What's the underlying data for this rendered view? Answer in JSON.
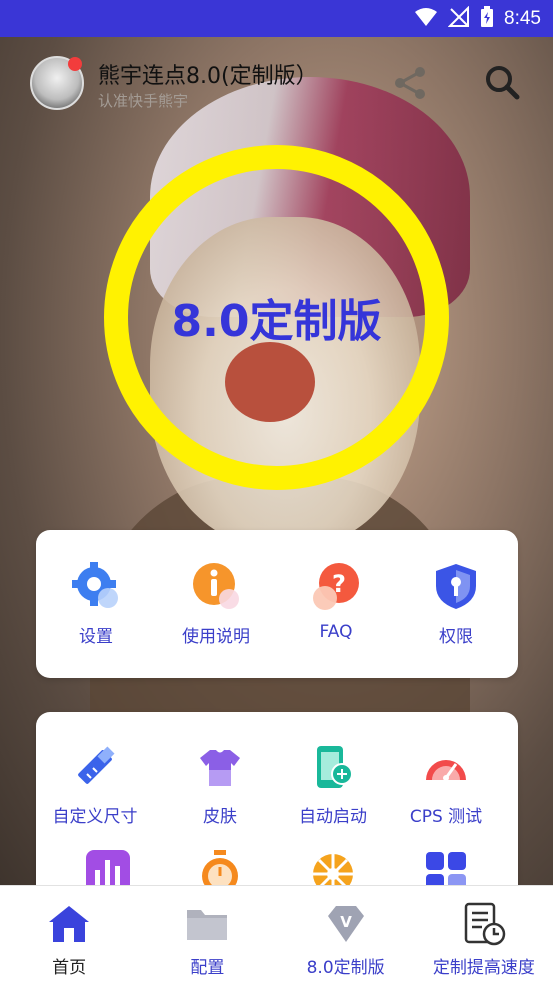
{
  "status": {
    "time": "8:45"
  },
  "header": {
    "title": "熊宇连点8.0(定制版）",
    "subtitle": "认准快手熊宇"
  },
  "hero": {
    "ring_label": "8.0定制版",
    "ring_color": "#fff201",
    "label_color": "#3535d9"
  },
  "quick_menu": [
    {
      "label": "设置",
      "icon": "gear-icon"
    },
    {
      "label": "使用说明",
      "icon": "info-icon"
    },
    {
      "label": "FAQ",
      "icon": "question-icon"
    },
    {
      "label": "权限",
      "icon": "shield-key-icon"
    }
  ],
  "tools_menu": [
    {
      "label": "自定义尺寸",
      "icon": "ruler-pencil-icon"
    },
    {
      "label": "皮肤",
      "icon": "tshirt-icon"
    },
    {
      "label": "自动启动",
      "icon": "phone-link-icon"
    },
    {
      "label": "CPS 测试",
      "icon": "speedometer-icon"
    },
    {
      "label": "",
      "icon": "bar-chart-icon"
    },
    {
      "label": "",
      "icon": "stopwatch-icon"
    },
    {
      "label": "",
      "icon": "wheel-icon"
    },
    {
      "label": "",
      "icon": "apps-grid-icon"
    }
  ],
  "bottom_nav": [
    {
      "label": "首页",
      "icon": "home-icon",
      "active": true
    },
    {
      "label": "配置",
      "icon": "folder-icon",
      "active": false
    },
    {
      "label": "8.0定制版",
      "icon": "diamond-v-icon",
      "active": false
    },
    {
      "label": "定制提高速度",
      "icon": "document-clock-icon",
      "active": false
    }
  ],
  "colors": {
    "accent": "#3a36d6",
    "label_blue": "#3b3fc9",
    "status_bar": "#3a36d6"
  }
}
